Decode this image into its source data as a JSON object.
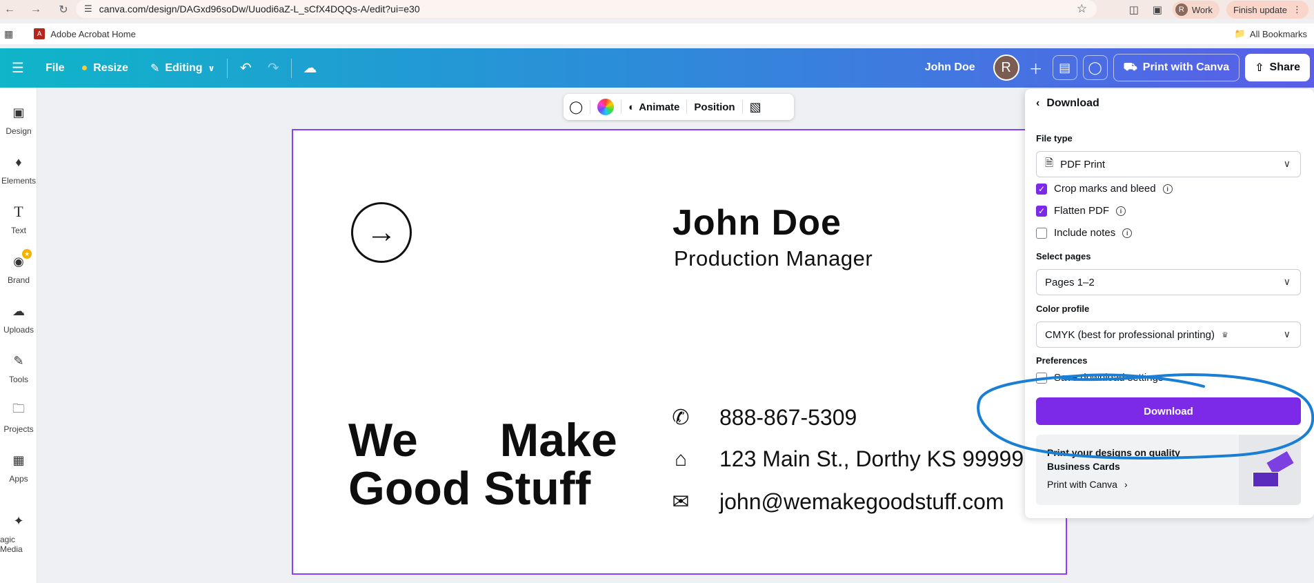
{
  "browser": {
    "url": "canva.com/design/DAGxd96soDw/Uuodi6aZ-L_sCfX4DQQs-A/edit?ui=e30",
    "profile_label": "Work",
    "profile_initial": "R",
    "update_label": "Finish update",
    "bookmark": "Adobe Acrobat Home",
    "all_bookmarks": "All Bookmarks"
  },
  "header": {
    "file": "File",
    "resize": "Resize",
    "editing": "Editing",
    "owner": "John Doe",
    "avatar_initial": "R",
    "print": "Print with Canva",
    "share": "Share"
  },
  "sidebar": {
    "items": [
      {
        "label": "Design",
        "icon": "design-icon"
      },
      {
        "label": "Elements",
        "icon": "elements-icon"
      },
      {
        "label": "Text",
        "icon": "text-icon"
      },
      {
        "label": "Brand",
        "icon": "brand-icon"
      },
      {
        "label": "Uploads",
        "icon": "uploads-icon"
      },
      {
        "label": "Tools",
        "icon": "tools-icon"
      },
      {
        "label": "Projects",
        "icon": "projects-icon"
      },
      {
        "label": "Apps",
        "icon": "apps-icon"
      },
      {
        "label": "agic Media",
        "icon": "magic-media-icon"
      }
    ]
  },
  "toolbar": {
    "animate": "Animate",
    "position": "Position"
  },
  "card": {
    "name": "John Doe",
    "role": "Production Manager",
    "tagline_line1": "We Make",
    "tagline_line2": "Good Stuff",
    "phone": "888-867-5309",
    "address": "123 Main St., Dorthy KS 99999",
    "email": "john@wemakegoodstuff.com"
  },
  "download_panel": {
    "title": "Download",
    "file_type_label": "File type",
    "file_type_value": "PDF Print",
    "crop_marks": {
      "label": "Crop marks and bleed",
      "checked": true
    },
    "flatten": {
      "label": "Flatten PDF",
      "checked": true
    },
    "include_notes": {
      "label": "Include notes",
      "checked": false
    },
    "select_pages_label": "Select pages",
    "select_pages_value": "Pages 1–2",
    "color_profile_label": "Color profile",
    "color_profile_value": "CMYK (best for professional printing)",
    "preferences_label": "Preferences",
    "save_settings": {
      "label": "Save download settings",
      "checked": false
    },
    "download_button": "Download",
    "promo_title": "Print your designs on quality Business Cards",
    "promo_link": "Print with Canva"
  },
  "colors": {
    "accent": "#7d2ae8",
    "annotation": "#1a7fd4",
    "header_start": "#0fb5c9",
    "header_end": "#5a5ee8"
  }
}
